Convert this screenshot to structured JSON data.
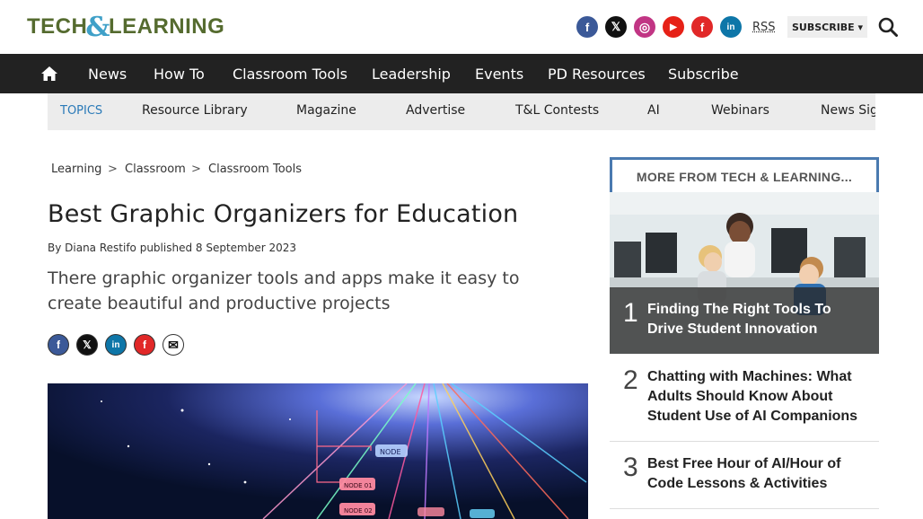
{
  "header": {
    "logo": {
      "part1": "TECH",
      "amp": "&",
      "part2": "LEARNING"
    },
    "socials": [
      {
        "name": "facebook-icon",
        "glyph": "f",
        "color": "#3b5998"
      },
      {
        "name": "x-twitter-icon",
        "glyph": "𝕏",
        "color": "#111111"
      },
      {
        "name": "instagram-icon",
        "glyph": "◎",
        "color": "#c13584"
      },
      {
        "name": "youtube-icon",
        "glyph": "▶",
        "color": "#e62117"
      },
      {
        "name": "flipboard-icon",
        "glyph": "f",
        "color": "#e12828"
      },
      {
        "name": "linkedin-icon",
        "glyph": "in",
        "color": "#0e76a8"
      }
    ],
    "rss_label": "RSS",
    "subscribe_label": "SUBSCRIBE ▾"
  },
  "nav": {
    "items": [
      "News",
      "How To",
      "Classroom Tools",
      "Leadership",
      "Events",
      "PD Resources",
      "Subscribe"
    ]
  },
  "topics": {
    "items": [
      "TOPICS",
      "Resource Library",
      "Magazine",
      "Advertise",
      "T&L Contests",
      "AI",
      "Webinars",
      "News Sig"
    ]
  },
  "breadcrumb": {
    "items": [
      "Learning",
      "Classroom",
      "Classroom Tools"
    ],
    "separator": ">"
  },
  "article": {
    "title": "Best Graphic Organizers for Education",
    "byline": "By Diana Restifo published 8 September 2023",
    "standfirst": "There graphic organizer tools and apps make it easy to create beautiful and productive projects",
    "share_icons": [
      {
        "name": "share-facebook-icon",
        "glyph": "f",
        "color": "#3b5998"
      },
      {
        "name": "share-x-icon",
        "glyph": "𝕏",
        "color": "#111111"
      },
      {
        "name": "share-linkedin-icon",
        "glyph": "in",
        "color": "#0e76a8"
      },
      {
        "name": "share-flipboard-icon",
        "glyph": "f",
        "color": "#e12828"
      },
      {
        "name": "share-email-icon",
        "glyph": "✉",
        "color": "#111111"
      }
    ],
    "hero_labels": [
      "NODE",
      "NODE 01",
      "NODE 02"
    ]
  },
  "sidebar": {
    "heading": "MORE FROM TECH & LEARNING...",
    "items": [
      {
        "rank": "1",
        "title": "Finding The Right Tools To Drive Student Innovation"
      },
      {
        "rank": "2",
        "title": "Chatting with Machines: What Adults Should Know About Student Use of AI Companions"
      },
      {
        "rank": "3",
        "title": "Best Free Hour of AI/Hour of Code Lessons & Activities"
      }
    ]
  },
  "colors": {
    "nav_bg": "#222222",
    "topics_bg": "#ececec",
    "topics_accent": "#2a7ab8",
    "sidebar_border": "#4a7ab0",
    "logo_green": "#556b2f",
    "logo_blue": "#3fa0c8"
  }
}
